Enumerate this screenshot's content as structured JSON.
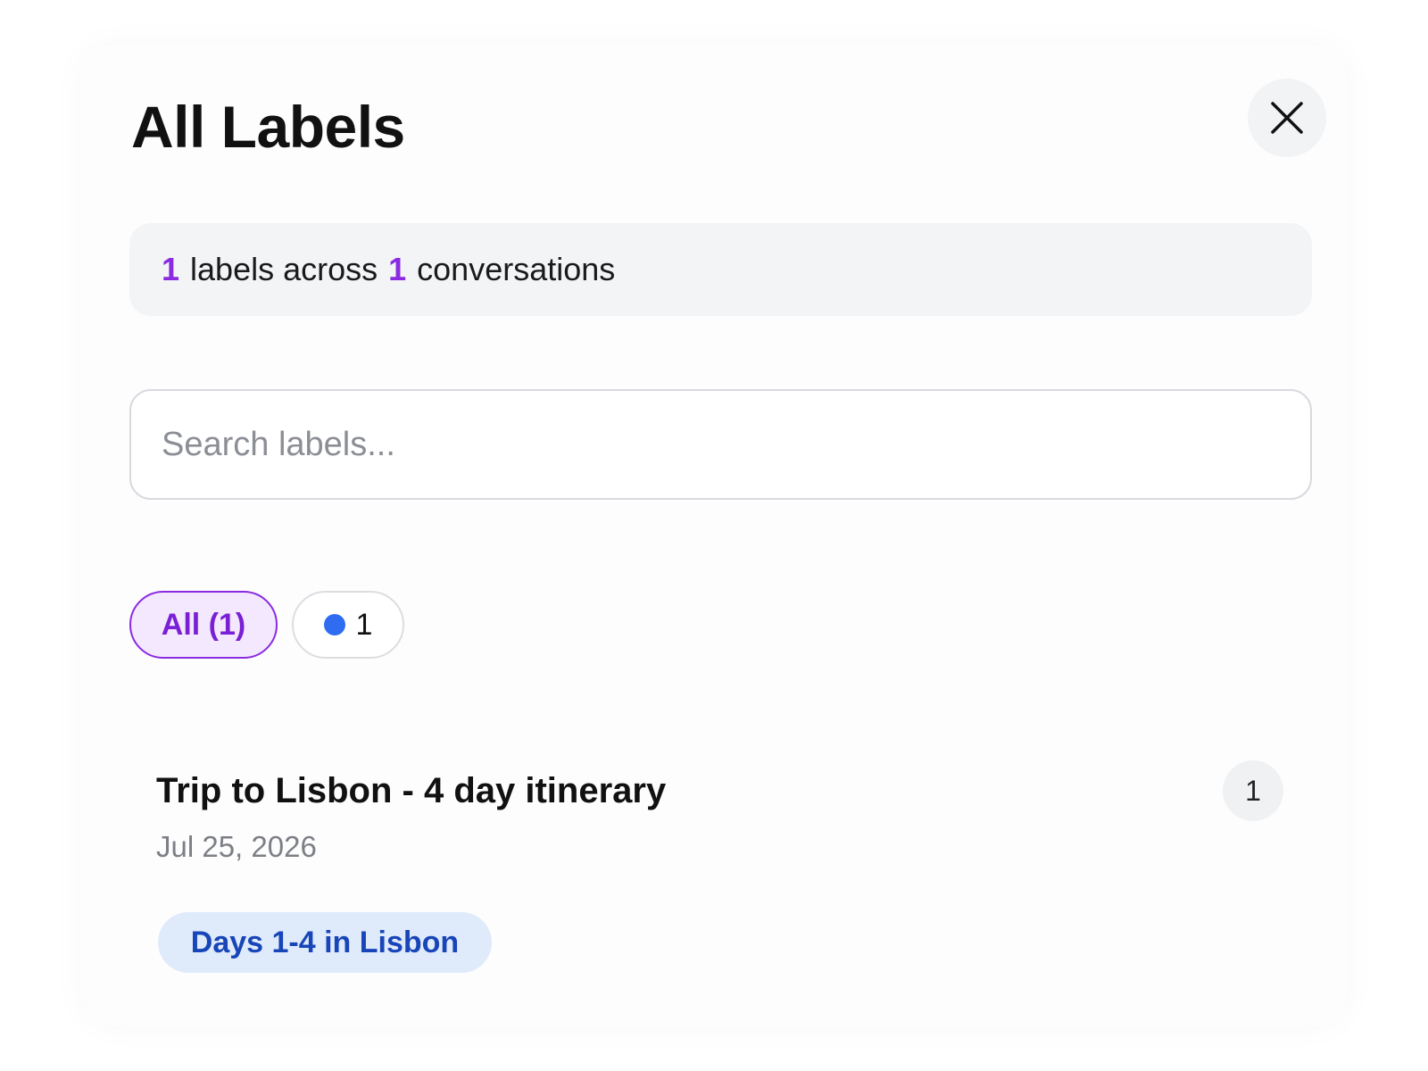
{
  "dialog": {
    "title": "All Labels",
    "close_icon": "close-icon"
  },
  "summary": {
    "label_count": "1",
    "labels_text": "labels across",
    "conversation_count": "1",
    "conversations_text": "conversations",
    "accent_color": "#8a2be2"
  },
  "search": {
    "placeholder": "Search labels...",
    "value": ""
  },
  "filters": [
    {
      "label": "All (1)",
      "selected": true
    },
    {
      "label": "1",
      "dot_color": "#2f6cf2",
      "selected": false
    }
  ],
  "conversations": [
    {
      "title": "Trip to Lisbon - 4 day itinerary",
      "date": "Jul 25, 2026",
      "count": "1",
      "labels": [
        "Days 1-4 in Lisbon"
      ]
    }
  ]
}
